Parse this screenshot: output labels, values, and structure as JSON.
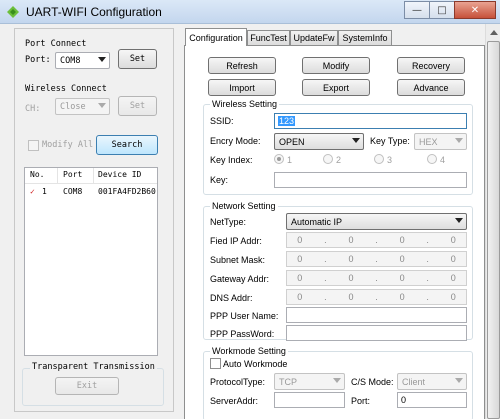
{
  "window": {
    "title": "UART-WIFI Configuration",
    "minimize_glyph": "—",
    "maximize_glyph": "□",
    "close_glyph": "✕",
    "icon": "app-logo-icon"
  },
  "left": {
    "port_connect": {
      "title": "Port Connect",
      "port_label": "Port:",
      "port_value": "COM8",
      "set_label": "Set"
    },
    "wireless_connect": {
      "title": "Wireless Connect",
      "ch_label": "CH:",
      "ch_value": "Close",
      "set_label": "Set"
    },
    "modify_all_label": "Modify All",
    "search_label": "Search",
    "device_list": {
      "columns": [
        "No.",
        "Port",
        "Device ID"
      ],
      "rows": [
        {
          "check": "✓",
          "no": "1",
          "port": "COM8",
          "device_id": "001FA4FD2B60"
        }
      ]
    },
    "transparent": {
      "title": "Transparent Transmission",
      "exit_label": "Exit"
    }
  },
  "tabs": [
    {
      "label": "Configuration",
      "active": true
    },
    {
      "label": "FuncTest",
      "active": false
    },
    {
      "label": "UpdateFw",
      "active": false
    },
    {
      "label": "SystemInfo",
      "active": false
    }
  ],
  "toolbar": {
    "refresh": "Refresh",
    "modify": "Modify",
    "recovery": "Recovery",
    "import": "Import",
    "export": "Export",
    "advance": "Advance"
  },
  "wireless_setting": {
    "title": "Wireless Setting",
    "ssid_label": "SSID:",
    "ssid_value": "123",
    "encry_label": "Encry Mode:",
    "encry_value": "OPEN",
    "key_type_label": "Key Type:",
    "key_type_value": "HEX",
    "key_index_label": "Key Index:",
    "key_index_options": [
      "1",
      "2",
      "3",
      "4"
    ],
    "key_index_selected": "1",
    "key_label": "Key:",
    "key_value": ""
  },
  "network_setting": {
    "title": "Network Setting",
    "nettype_label": "NetType:",
    "nettype_value": "Automatic IP",
    "fixed_ip_label": "Fied IP Addr:",
    "subnet_label": "Subnet Mask:",
    "gateway_label": "Gateway Addr:",
    "dns_label": "DNS Addr:",
    "ip_octets": [
      "0",
      "0",
      "0",
      "0"
    ],
    "ip_dot": ".",
    "ppp_user_label": "PPP User Name:",
    "ppp_pass_label": "PPP PassWord:",
    "ppp_user_value": "",
    "ppp_pass_value": ""
  },
  "workmode_setting": {
    "title": "Workmode Setting",
    "auto_workmode_label": "Auto Workmode",
    "protocol_label": "ProtocolType:",
    "protocol_value": "TCP",
    "cs_mode_label": "C/S Mode:",
    "cs_mode_value": "Client",
    "server_addr_label": "ServerAddr:",
    "server_addr_value": "",
    "port_label": "Port:",
    "port_value": "0"
  },
  "colors": {
    "selection": "#3399ff",
    "check_red": "#d02020",
    "focus_border": "#3c7fb1"
  }
}
